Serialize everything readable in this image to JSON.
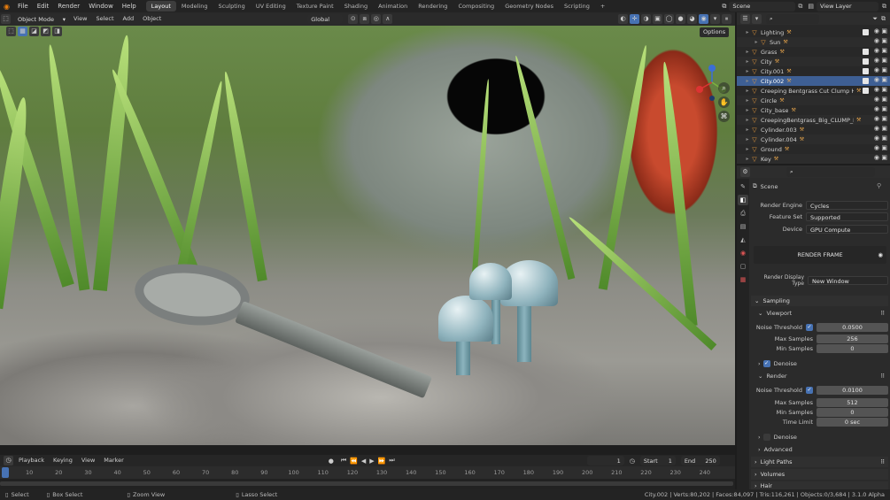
{
  "topbar": {
    "menus": [
      "File",
      "Edit",
      "Render",
      "Window",
      "Help"
    ],
    "workspaces": [
      "Layout",
      "Modeling",
      "Sculpting",
      "UV Editing",
      "Texture Paint",
      "Shading",
      "Animation",
      "Rendering",
      "Compositing",
      "Geometry Nodes",
      "Scripting"
    ],
    "active_workspace": "Layout",
    "add_tab": "+",
    "scene": "Scene",
    "view_layer": "View Layer"
  },
  "viewport_header": {
    "mode": "Object Mode",
    "menus": [
      "View",
      "Select",
      "Add",
      "Object"
    ],
    "orientation": "Global",
    "options": "Options"
  },
  "timeline": {
    "menus": [
      "Playback",
      "Keying",
      "View",
      "Marker"
    ],
    "current_frame": "1",
    "start_label": "Start",
    "start": "1",
    "end_label": "End",
    "end": "250",
    "ticks": [
      "0",
      "10",
      "20",
      "30",
      "40",
      "50",
      "60",
      "70",
      "80",
      "90",
      "100",
      "110",
      "120",
      "130",
      "140",
      "150",
      "160",
      "170",
      "180",
      "190",
      "200",
      "210",
      "220",
      "230",
      "240"
    ]
  },
  "status": {
    "left": [
      "Select",
      "Box Select",
      "Zoom View",
      "Lasso Select"
    ],
    "stats": "City.002 | Verts:80,202 | Faces:84,097 | Tris:116,261 | Objects:0/3,684 | 3.1.0 Alpha"
  },
  "outliner": {
    "items": [
      {
        "name": "Lighting",
        "indent": 0,
        "selected": false,
        "checked": true
      },
      {
        "name": "Sun",
        "indent": 1,
        "selected": false,
        "checked": false
      },
      {
        "name": "Grass",
        "indent": 0,
        "selected": false,
        "checked": true
      },
      {
        "name": "City",
        "indent": 0,
        "selected": false,
        "checked": true
      },
      {
        "name": "City.001",
        "indent": 0,
        "selected": false,
        "checked": true
      },
      {
        "name": "City.002",
        "indent": 0,
        "selected": true,
        "checked": true
      },
      {
        "name": "Creeping Bentgrass Cut Clump High",
        "indent": 0,
        "selected": false,
        "checked": true
      },
      {
        "name": "Circle",
        "indent": 0,
        "selected": false,
        "checked": false
      },
      {
        "name": "City_base",
        "indent": 0,
        "selected": false,
        "checked": false
      },
      {
        "name": "CreepingBentgrass_Big_CLUMP_HIGH",
        "indent": 0,
        "selected": false,
        "checked": false
      },
      {
        "name": "Cylinder.003",
        "indent": 0,
        "selected": false,
        "checked": false
      },
      {
        "name": "Cylinder.004",
        "indent": 0,
        "selected": false,
        "checked": false
      },
      {
        "name": "Ground",
        "indent": 0,
        "selected": false,
        "checked": false
      },
      {
        "name": "Key",
        "indent": 0,
        "selected": false,
        "checked": false
      }
    ]
  },
  "properties": {
    "scene": "Scene",
    "render_engine_label": "Render Engine",
    "render_engine": "Cycles",
    "feature_set_label": "Feature Set",
    "feature_set": "Supported",
    "device_label": "Device",
    "device": "GPU Compute",
    "render_frame": "RENDER FRAME",
    "display_type_label": "Render Display Type",
    "display_type": "New Window",
    "sampling": "Sampling",
    "viewport": "Viewport",
    "vp_noise_threshold_label": "Noise Threshold",
    "vp_noise_threshold": "0.0500",
    "vp_max_samples_label": "Max Samples",
    "vp_max_samples": "256",
    "vp_min_samples_label": "Min Samples",
    "vp_min_samples": "0",
    "vp_denoise": "Denoise",
    "render": "Render",
    "r_noise_threshold_label": "Noise Threshold",
    "r_noise_threshold": "0.0100",
    "r_max_samples_label": "Max Samples",
    "r_max_samples": "512",
    "r_min_samples_label": "Min Samples",
    "r_min_samples": "0",
    "time_limit_label": "Time Limit",
    "time_limit": "0 sec",
    "r_denoise": "Denoise",
    "advanced": "Advanced",
    "light_paths": "Light Paths",
    "volumes": "Volumes",
    "hair": "Hair"
  },
  "colors": {
    "accent": "#4772b3",
    "selection": "#3e5f94",
    "object_orange": "#e89a3c"
  }
}
